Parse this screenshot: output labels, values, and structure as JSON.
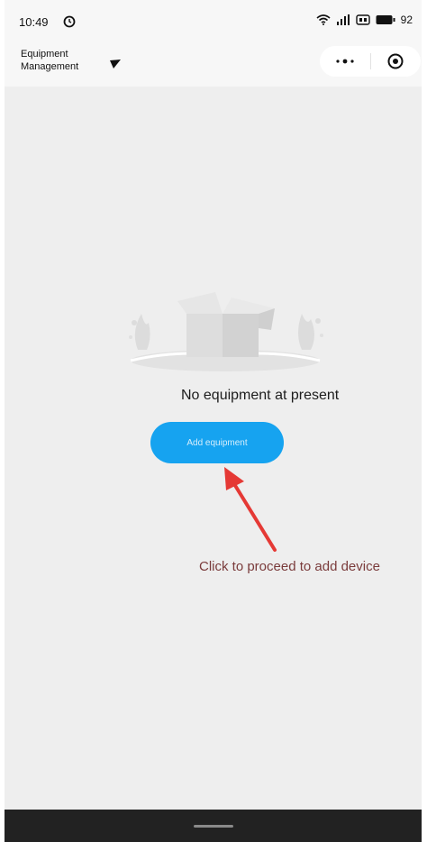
{
  "status_bar": {
    "time": "10:49",
    "battery": "92",
    "icons": [
      "alarm-icon",
      "wifi-icon",
      "signal-icon",
      "hd-icon",
      "battery-icon"
    ]
  },
  "header": {
    "title": "Equipment Management",
    "icons": [
      "dropdown-icon",
      "more-icon",
      "target-icon"
    ]
  },
  "empty_state": {
    "message": "No equipment at present",
    "button_label": "Add equipment",
    "illustration": "empty-box-icon"
  },
  "annotation": {
    "text": "Click to proceed to add device",
    "color": "#e53935",
    "text_color": "#7a3b3b"
  },
  "colors": {
    "accent": "#16a3f0",
    "background": "#eeeeee",
    "bottom_bar": "#222222"
  }
}
